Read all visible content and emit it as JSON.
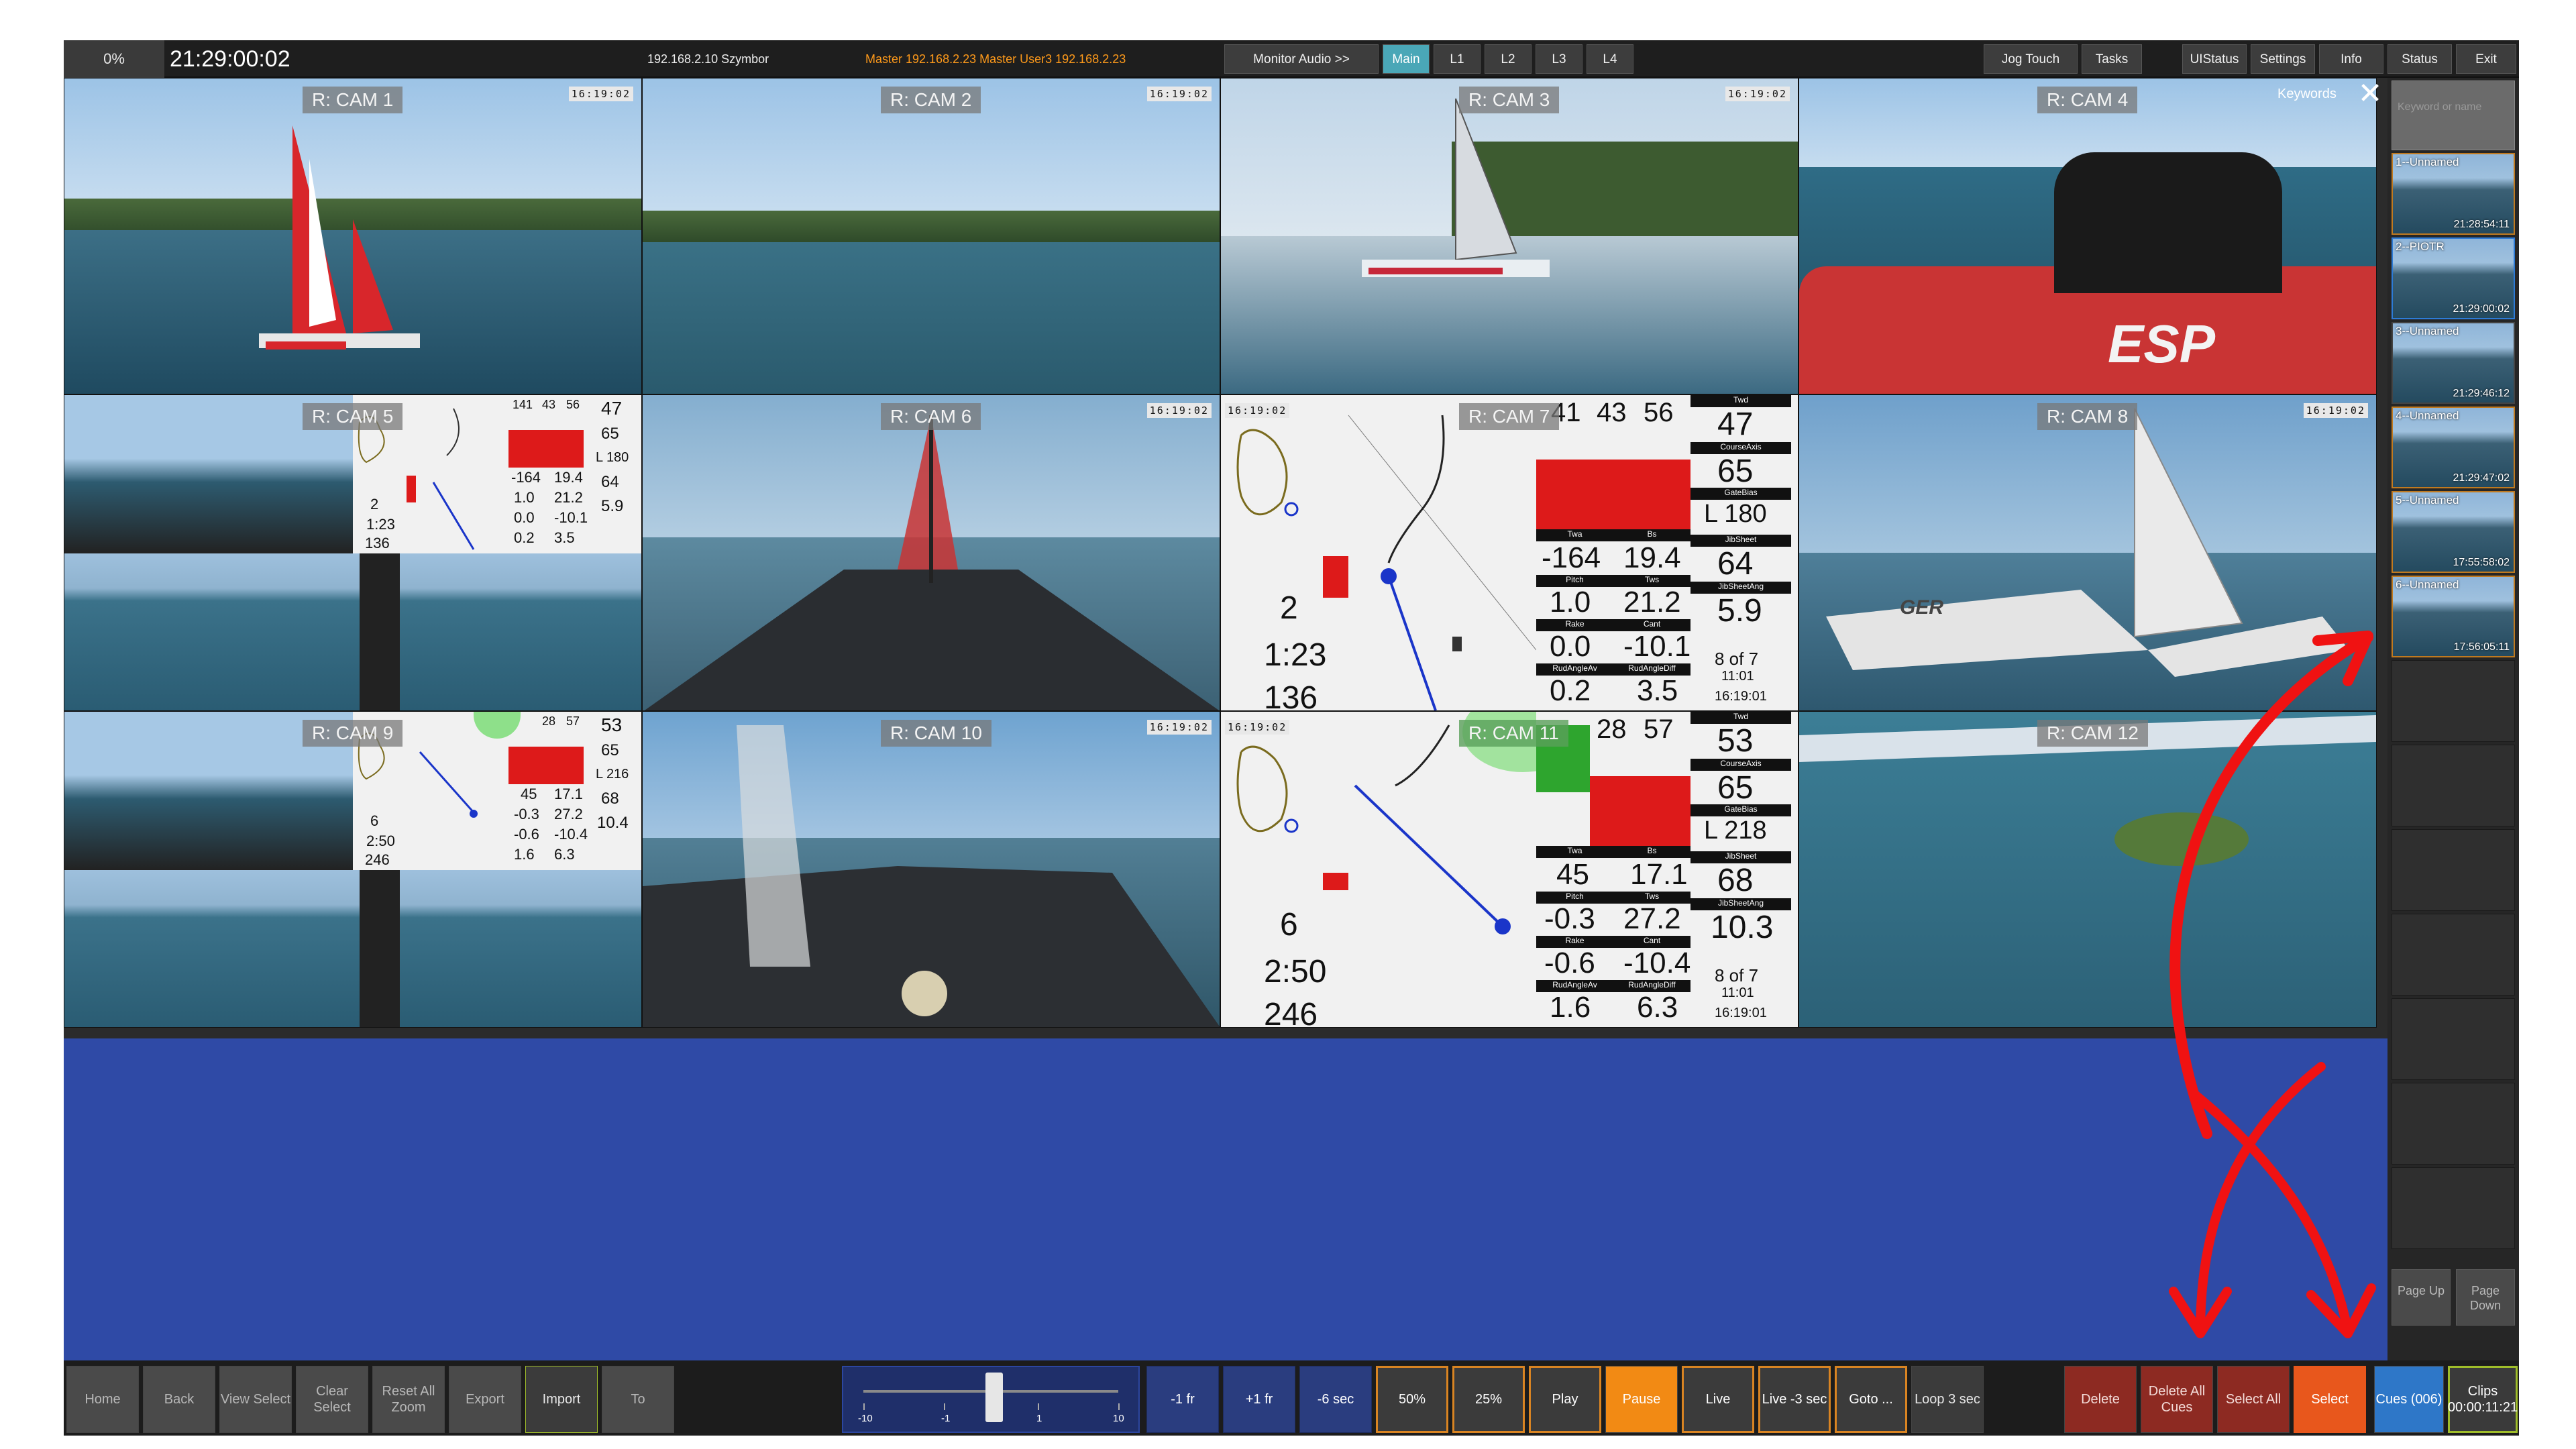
{
  "topbar": {
    "percent": "0%",
    "timecode": "21:29:00:02",
    "host": "192.168.2.10 Szymbor",
    "master_info": "Master 192.168.2.23   Master   User3   192.168.2.23",
    "monitor_audio": "Monitor Audio >>",
    "main": "Main",
    "l1": "L1",
    "l2": "L2",
    "l3": "L3",
    "l4": "L4",
    "jog_touch": "Jog Touch",
    "tasks": "Tasks",
    "uistatus": "UIStatus",
    "settings": "Settings",
    "info": "Info",
    "status": "Status",
    "exit": "Exit"
  },
  "cameras": [
    {
      "label": "R: CAM 1",
      "tc": "16:19:02"
    },
    {
      "label": "R: CAM 2",
      "tc": "16:19:02"
    },
    {
      "label": "R: CAM 3",
      "tc": "16:19:02"
    },
    {
      "label": "R: CAM 4",
      "tc": ""
    },
    {
      "label": "R: CAM 5",
      "tc": ""
    },
    {
      "label": "R: CAM 6",
      "tc": "16:19:02"
    },
    {
      "label": "R: CAM 7",
      "tc": "16:19:02"
    },
    {
      "label": "R: CAM 8",
      "tc": "16:19:02"
    },
    {
      "label": "R: CAM 9",
      "tc": ""
    },
    {
      "label": "R: CAM 10",
      "tc": "16:19:02"
    },
    {
      "label": "R: CAM 11",
      "tc": "16:19:02"
    },
    {
      "label": "R: CAM 12",
      "tc": ""
    }
  ],
  "cam4_extra": {
    "boat_text": "ESP"
  },
  "cam8_extra": {
    "boat_text": "GER"
  },
  "telemetry7": {
    "top1": "41",
    "top2": "43",
    "top3": "56",
    "top4": "47",
    "l1": "65",
    "l2": "L 180",
    "l3": "64",
    "l4": "5.9",
    "twa": "-164",
    "tws": "19.4",
    "pitch": "1.0",
    "tws2": "21.2",
    "rake": "0.0",
    "cant": "-10.1",
    "rud": "0.2",
    "rud2": "3.5",
    "left1": "2",
    "left2": "1:23",
    "left3": "136",
    "of": "8 of 7",
    "t1": "11:01",
    "t2": "16:19:01",
    "cap_twd": "Twd",
    "cap_course": "CourseAxis",
    "cap_gate": "GateBias",
    "cap_jib": "JibSheet",
    "cap_jibang": "JibSheetAng",
    "cap_twa": "Twa",
    "cap_bs": "Bs",
    "cap_pitch": "Pitch",
    "cap_tws": "Tws",
    "cap_rake": "Rake",
    "cap_cant": "Cant",
    "cap_rud": "RudAngleAv",
    "cap_ruddiff": "RudAngleDiff"
  },
  "telemetry11": {
    "top1": "28",
    "top2": "57",
    "top3": "53",
    "l1": "65",
    "l2": "L 218",
    "l3": "68",
    "l4": "10.3",
    "twa": "45",
    "tws": "17.1",
    "pitch": "-0.3",
    "tws2": "27.2",
    "rake": "-0.6",
    "cant": "-10.4",
    "rud": "1.6",
    "rud2": "6.3",
    "left1": "6",
    "left2": "2:50",
    "left3": "246",
    "of": "8 of 7",
    "t1": "11:01",
    "t2": "16:19:01",
    "cap_twd": "Twd",
    "cap_course": "CourseAxis",
    "cap_gate": "GateBias",
    "cap_jib": "JibSheet",
    "cap_jibang": "JibSheetAng",
    "cap_twa": "Twa",
    "cap_bs": "Bs",
    "cap_pitch": "Pitch",
    "cap_tws": "Tws",
    "cap_rake": "Rake",
    "cap_cant": "Cant",
    "cap_rud": "RudAngleAv",
    "cap_ruddiff": "RudAngleDiff"
  },
  "mini5": {
    "a": "141",
    "b": "43",
    "c": "56",
    "d": "47",
    "e": "65",
    "f": "L 180",
    "g": "64",
    "h": "5.9",
    "v1": "-164",
    "v2": "19.4",
    "v3": "1.0",
    "v4": "21.2",
    "v5": "0.0",
    "v6": "-10.1",
    "v7": "0.2",
    "v8": "3.5",
    "left1": "2",
    "left2": "1:23",
    "left3": "136"
  },
  "mini9": {
    "a": "28",
    "b": "57",
    "c": "53",
    "e": "65",
    "f": "L 216",
    "g": "68",
    "h": "10.4",
    "v1": "45",
    "v2": "17.1",
    "v3": "-0.3",
    "v4": "27.2",
    "v5": "-0.6",
    "v6": "-10.4",
    "v7": "1.6",
    "v8": "6.3",
    "left1": "6",
    "left2": "2:50",
    "left3": "246"
  },
  "sidebar": {
    "keywords": "Keywords",
    "keyword_placeholder": "Keyword or name",
    "cues": [
      {
        "name": "1--Unnamed",
        "time": "21:28:54:11"
      },
      {
        "name": "2--PIOTR",
        "time": "21:29:00:02"
      },
      {
        "name": "3--Unnamed",
        "time": "21:29:46:12"
      },
      {
        "name": "4--Unnamed",
        "time": "21:29:47:02"
      },
      {
        "name": "5--Unnamed",
        "time": "17:55:58:02"
      },
      {
        "name": "6--Unnamed",
        "time": "17:56:05:11"
      }
    ],
    "page_up": "Page Up",
    "page_down": "Page Down"
  },
  "bottombar": {
    "home": "Home",
    "back": "Back",
    "view_select": "View Select",
    "clear_select": "Clear Select",
    "reset_all_zoom": "Reset All Zoom",
    "export": "Export",
    "import": "Import",
    "to": "To",
    "jog_labels": [
      "-10",
      "-1",
      "1",
      "10"
    ],
    "minus_1fr": "-1 fr",
    "plus_1fr": "+1 fr",
    "minus_6sec": "-6 sec",
    "p50": "50%",
    "p25": "25%",
    "play": "Play",
    "pause": "Pause",
    "live": "Live",
    "live_minus_3": "Live -3 sec",
    "goto": "Goto ...",
    "loop": "Loop 3 sec",
    "delete": "Delete",
    "delete_all_cues": "Delete All Cues",
    "select_all": "Select All",
    "select": "Select",
    "cues": "Cues (006)",
    "clips": "Clips 00:00:11:21"
  },
  "colors": {
    "accent_blue": "#2f4aa6",
    "orange": "#f28a14",
    "annotation_red": "#f01212"
  }
}
